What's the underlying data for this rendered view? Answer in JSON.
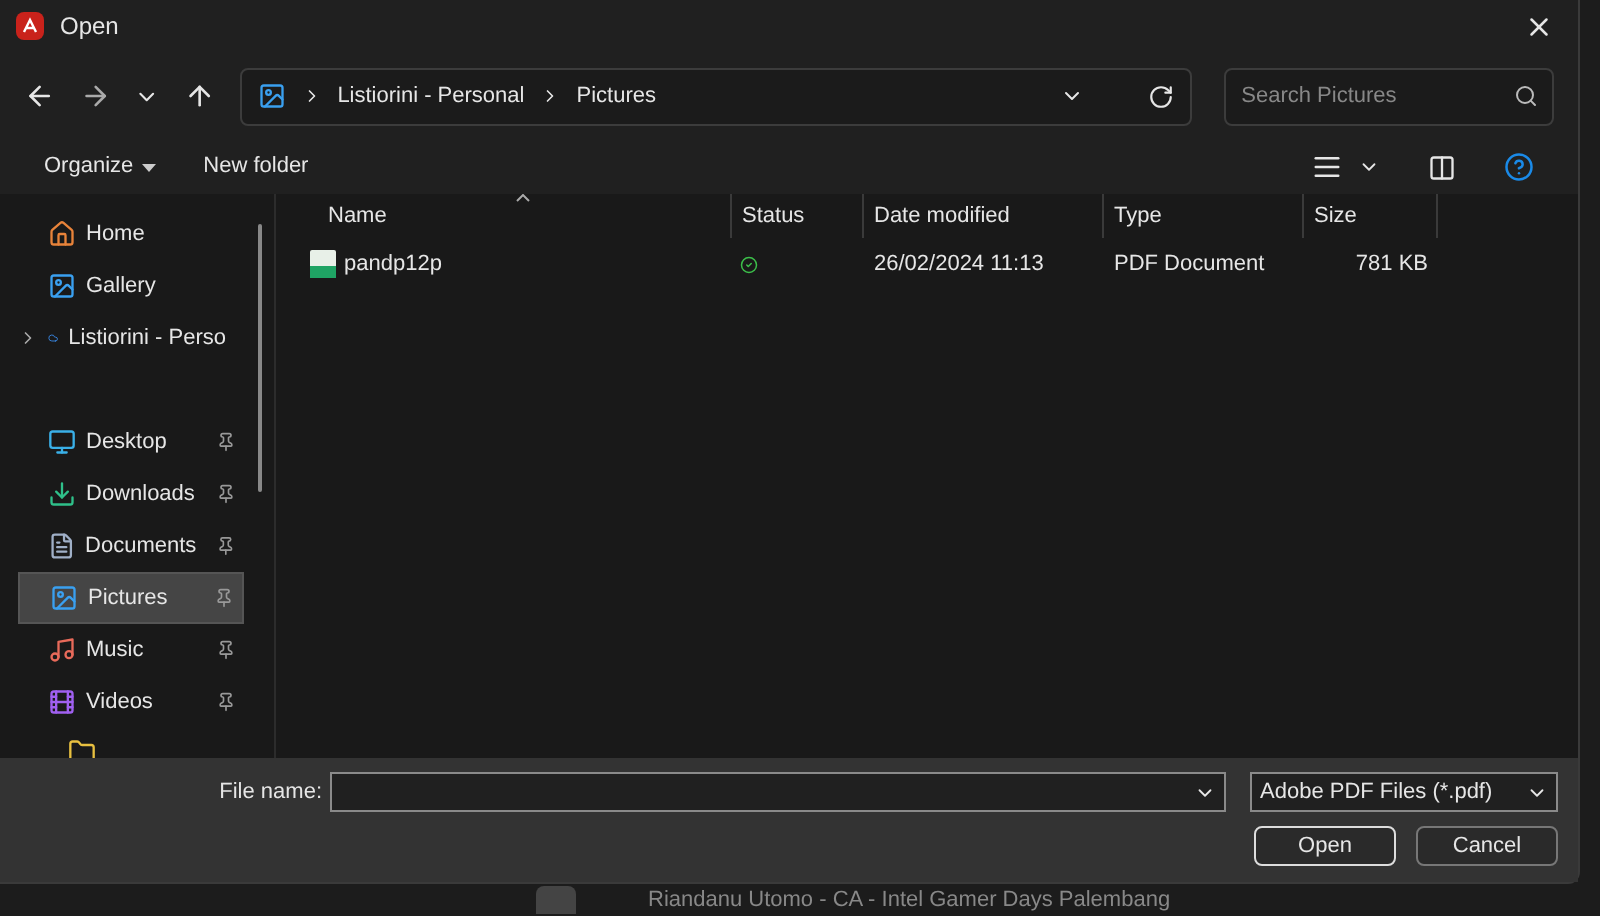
{
  "window": {
    "title": "Open"
  },
  "address": {
    "segments": [
      "Listiorini - Personal",
      "Pictures"
    ]
  },
  "search": {
    "placeholder": "Search Pictures"
  },
  "toolbar": {
    "organize": "Organize",
    "new_folder": "New folder"
  },
  "sidebar": {
    "items": [
      {
        "label": "Home",
        "kind": "home",
        "selected": false,
        "pinned": false,
        "expandable": false
      },
      {
        "label": "Gallery",
        "kind": "gallery",
        "selected": false,
        "pinned": false,
        "expandable": false
      },
      {
        "label": "Listiorini - Perso",
        "kind": "cloud",
        "selected": false,
        "pinned": false,
        "expandable": true
      },
      {
        "label": "Desktop",
        "kind": "desktop",
        "selected": false,
        "pinned": true,
        "expandable": false
      },
      {
        "label": "Downloads",
        "kind": "downloads",
        "selected": false,
        "pinned": true,
        "expandable": false
      },
      {
        "label": "Documents",
        "kind": "documents",
        "selected": false,
        "pinned": true,
        "expandable": false
      },
      {
        "label": "Pictures",
        "kind": "pictures",
        "selected": true,
        "pinned": true,
        "expandable": false
      },
      {
        "label": "Music",
        "kind": "music",
        "selected": false,
        "pinned": true,
        "expandable": false
      },
      {
        "label": "Videos",
        "kind": "videos",
        "selected": false,
        "pinned": true,
        "expandable": false
      }
    ]
  },
  "table": {
    "columns": [
      "Name",
      "Status",
      "Date modified",
      "Type",
      "Size"
    ],
    "rows": [
      {
        "name": "pandp12p",
        "date": "26/02/2024 11:13",
        "type": "PDF Document",
        "size": "781 KB"
      }
    ]
  },
  "footer": {
    "file_name_label": "File name:",
    "file_type": "Adobe PDF Files (*.pdf)",
    "open": "Open",
    "cancel": "Cancel"
  },
  "background": {
    "text": "Riandanu Utomo - CA - Intel Gamer Days Palembang"
  }
}
